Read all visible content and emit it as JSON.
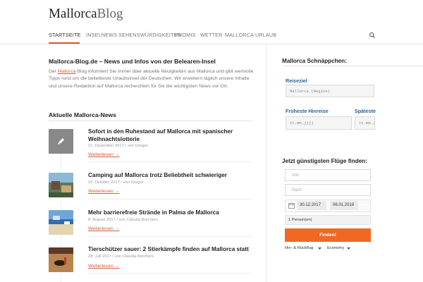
{
  "logo": {
    "part1": "Mallorca",
    "part2": "Blog"
  },
  "nav": {
    "items": [
      {
        "label": "STARTSEITE",
        "active": true
      },
      {
        "label": "INSELNEWS",
        "active": false
      },
      {
        "label": "SEHENSWÜRDIGKEITEN",
        "active": false
      },
      {
        "label": "PROMIS",
        "active": false
      },
      {
        "label": "WETTER",
        "active": false
      },
      {
        "label": "MALLORCA URLAUB",
        "active": false
      }
    ],
    "search_icon": "search-icon"
  },
  "main": {
    "heading": "Mallorca-Blog.de – News und Infos von der Belearen-Insel",
    "intro_before": "Der ",
    "intro_link": "Mallorca",
    "intro_after": " Blog informiert Sie immer über aktuelle Neuigkeiten aus Mallorca und gibt wertvolle Tipps rund um die beliebteste Urlaubsinsel der Deutschen. Wir erweitern täglich unsere Inhalte und unsere Redaktion auf Mallorca recherchiert für Sie die wichtigsten News vor Ort.",
    "news_section_title": "Aktuelle Mallorca-News",
    "news": [
      {
        "title": "Sofort in den Ruhestand auf Mallorca mit spanischer Weihnachtslotterie",
        "date": "21. Dezember 2017",
        "author": "/ von Gregor",
        "more": "Weiterlesen →",
        "thumb": "pencil-icon"
      },
      {
        "title": "Camping auf Mallorca trotz Beliebtheit schwieriger",
        "date": "25. Oktober 2017",
        "author": "/ von Gregor",
        "more": "Weiterlesen →",
        "thumb": "photo"
      },
      {
        "title": "Mehr barrierefreie Strände in Palma de Mallorca",
        "date": "8. August 2017",
        "author": "/ von Claudia Borchers",
        "more": "Weiterlesen →",
        "thumb": "photo"
      },
      {
        "title": "Tierschützer sauer: 2 Stierkämpfe finden auf Mallorca statt",
        "date": "28. Juli 2017",
        "author": "/ von Claudia Borchers",
        "more": "Weiterlesen →",
        "thumb": "photo"
      }
    ]
  },
  "sidebar": {
    "deals_title": "Mallorca Schnäppchen:",
    "reiseziel_label": "Reiseziel",
    "reiseziel_value": "Mallorca (Region)",
    "hinreise_label": "Früheste Hinreise",
    "hinreise_value": "tt.mm.jjjj",
    "spaeteste_label": "Späteste",
    "spaeteste_value": "tt.mm.jjjj",
    "flights_title": "Jetzt günstigsten Flüge finden:",
    "von_placeholder": "Von",
    "nach_placeholder": "Nach",
    "date_from": "30.12.2017",
    "date_to": "06.01.2018",
    "persons": "1 Person(en)",
    "submit": "Finden!",
    "trip_type": "Hin- & Rückflug",
    "cabin": "Economy",
    "accent_color": "#f26722",
    "link_color": "#d65a3a"
  }
}
